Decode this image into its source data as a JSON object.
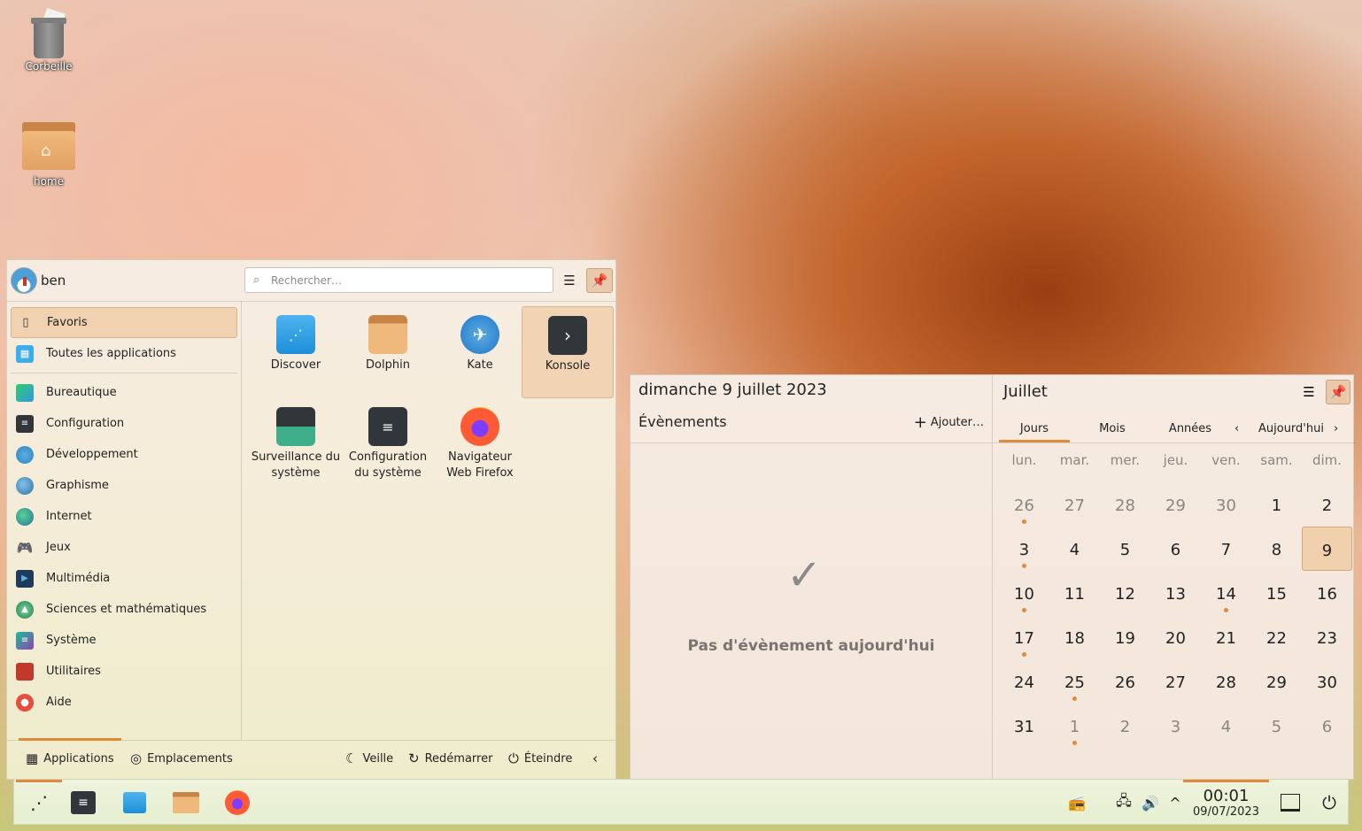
{
  "desktop": {
    "icons": [
      {
        "label": "Corbeille",
        "icon": "trash-icon"
      },
      {
        "label": "home",
        "icon": "home-folder-icon"
      }
    ]
  },
  "launcher": {
    "user": "ben",
    "search_placeholder": "Rechercher…",
    "categories": [
      {
        "label": "Favoris",
        "icon": "bookmark-icon",
        "active": true
      },
      {
        "label": "Toutes les applications",
        "icon": "grid-icon"
      },
      {
        "label": "Bureautique",
        "icon": "office-icon"
      },
      {
        "label": "Configuration",
        "icon": "settings-icon"
      },
      {
        "label": "Développement",
        "icon": "development-icon"
      },
      {
        "label": "Graphisme",
        "icon": "graphics-icon"
      },
      {
        "label": "Internet",
        "icon": "globe-icon"
      },
      {
        "label": "Jeux",
        "icon": "gamepad-icon"
      },
      {
        "label": "Multimédia",
        "icon": "multimedia-icon"
      },
      {
        "label": "Sciences et mathématiques",
        "icon": "science-icon"
      },
      {
        "label": "Système",
        "icon": "system-icon"
      },
      {
        "label": "Utilitaires",
        "icon": "toolbox-icon"
      },
      {
        "label": "Aide",
        "icon": "help-icon"
      }
    ],
    "apps": [
      {
        "label": "Discover",
        "icon": "discover-icon"
      },
      {
        "label": "Dolphin",
        "icon": "dolphin-icon"
      },
      {
        "label": "Kate",
        "icon": "kate-icon"
      },
      {
        "label": "Konsole",
        "icon": "konsole-icon",
        "active": true
      },
      {
        "label": "Surveillance du système",
        "icon": "system-monitor-icon"
      },
      {
        "label": "Configuration du système",
        "icon": "system-settings-icon"
      },
      {
        "label": "Navigateur Web Firefox",
        "icon": "firefox-icon"
      }
    ],
    "footer": {
      "tab_applications": "Applications",
      "tab_places": "Emplacements",
      "sleep": "Veille",
      "restart": "Redémarrer",
      "shutdown": "Éteindre"
    }
  },
  "calendar_panel": {
    "date_title": "dimanche 9 juillet 2023",
    "events_title": "Évènements",
    "add_label": "Ajouter…",
    "no_events": "Pas d'évènement aujourd'hui",
    "month": "Juillet",
    "tabs": [
      "Jours",
      "Mois",
      "Années"
    ],
    "active_tab": "Jours",
    "today_label": "Aujourd'hui",
    "weekdays": [
      "lun.",
      "mar.",
      "mer.",
      "jeu.",
      "ven.",
      "sam.",
      "dim."
    ],
    "weeks": [
      [
        {
          "d": "26",
          "o": true,
          "e": true
        },
        {
          "d": "27",
          "o": true
        },
        {
          "d": "28",
          "o": true
        },
        {
          "d": "29",
          "o": true
        },
        {
          "d": "30",
          "o": true
        },
        {
          "d": "1"
        },
        {
          "d": "2"
        }
      ],
      [
        {
          "d": "3",
          "e": true
        },
        {
          "d": "4"
        },
        {
          "d": "5"
        },
        {
          "d": "6"
        },
        {
          "d": "7"
        },
        {
          "d": "8"
        },
        {
          "d": "9",
          "t": true
        }
      ],
      [
        {
          "d": "10",
          "e": true
        },
        {
          "d": "11"
        },
        {
          "d": "12"
        },
        {
          "d": "13"
        },
        {
          "d": "14",
          "e": true
        },
        {
          "d": "15"
        },
        {
          "d": "16"
        }
      ],
      [
        {
          "d": "17",
          "e": true
        },
        {
          "d": "18"
        },
        {
          "d": "19"
        },
        {
          "d": "20"
        },
        {
          "d": "21"
        },
        {
          "d": "22"
        },
        {
          "d": "23"
        }
      ],
      [
        {
          "d": "24"
        },
        {
          "d": "25",
          "e": true
        },
        {
          "d": "26"
        },
        {
          "d": "27"
        },
        {
          "d": "28"
        },
        {
          "d": "29"
        },
        {
          "d": "30"
        }
      ],
      [
        {
          "d": "31"
        },
        {
          "d": "1",
          "o": true,
          "e": true
        },
        {
          "d": "2",
          "o": true
        },
        {
          "d": "3",
          "o": true
        },
        {
          "d": "4",
          "o": true
        },
        {
          "d": "5",
          "o": true
        },
        {
          "d": "6",
          "o": true
        }
      ]
    ]
  },
  "taskbar": {
    "apps": [
      "app-launcher-icon",
      "system-settings-icon",
      "discover-icon",
      "dolphin-icon",
      "firefox-icon"
    ],
    "clock_time": "00:01",
    "clock_date": "09/07/2023",
    "tray": [
      "radio-icon",
      "network-icon",
      "volume-icon",
      "chevron-up-icon"
    ]
  },
  "colors": {
    "accent": "#e28a3c",
    "active_bg": "#f0d2b1"
  }
}
